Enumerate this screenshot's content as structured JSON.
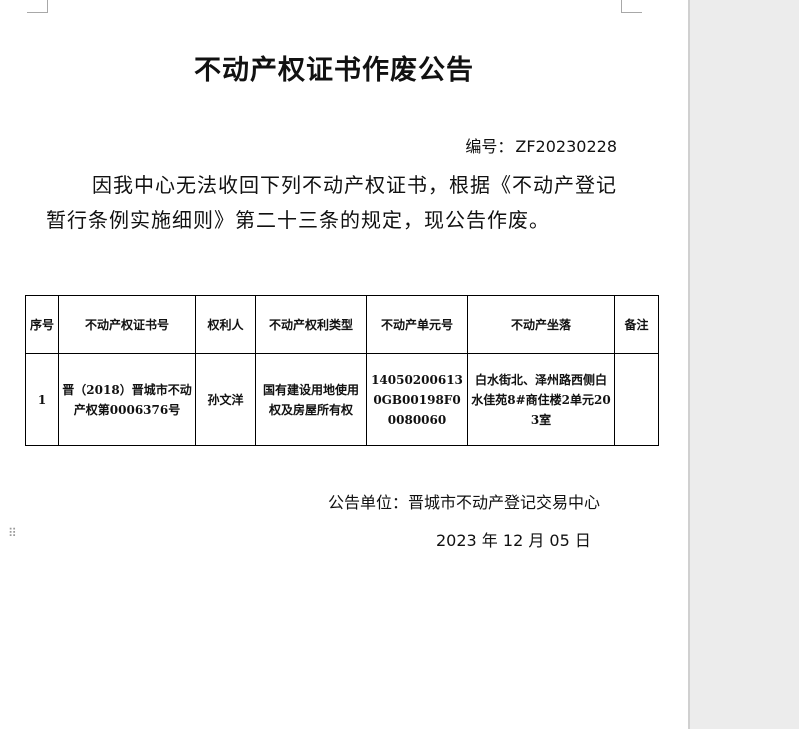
{
  "document": {
    "title": "不动产权证书作废公告",
    "doc_no_label": "编号：",
    "doc_no_value": "ZF20230228",
    "paragraph": "因我中心无法收回下列不动产权证书，根据《不动产登记暂行条例实施细则》第二十三条的规定，现公告作废。",
    "table": {
      "headers": [
        "序号",
        "不动产权证书号",
        "权利人",
        "不动产权利类型",
        "不动产单元号",
        "不动产坐落",
        "备注"
      ],
      "rows": [
        {
          "index": "1",
          "cert_no": "晋（2018）晋城市不动产权第0006376号",
          "owner": "孙文洋",
          "right_type": "国有建设用地使用权及房屋所有权",
          "unit_no": "140502006130GB00198F00080060",
          "location": "白水街北、泽州路西侧白水佳苑8#商住楼2单元203室",
          "remark": ""
        }
      ]
    },
    "notice_unit": "公告单位：晋城市不动产登记交易中心",
    "notice_date": "2023 年 12 月 05 日"
  },
  "icons": {
    "drag_handle": "drag-handle-icon"
  },
  "colors": {
    "page": "#ffffff",
    "gutter": "#ececec",
    "text": "#111111"
  }
}
